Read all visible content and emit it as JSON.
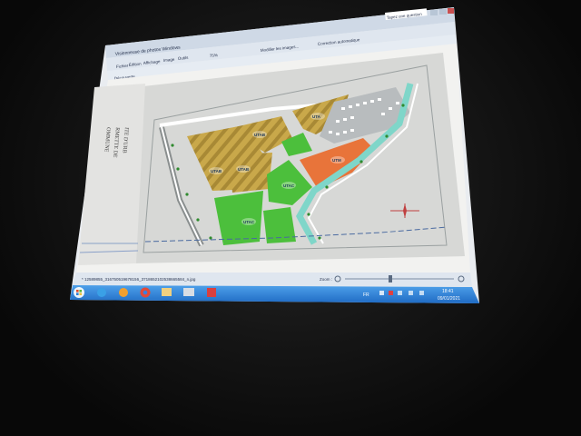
{
  "window": {
    "title": "Visionneuse de photos Windows",
    "search_placeholder": "Tapez une question"
  },
  "menu": {
    "items": [
      "Fichier",
      "Édition",
      "Affichage",
      "Image",
      "Outils"
    ],
    "zoom": "75%",
    "modify_images": "Modifier les images...",
    "auto_correct": "Correction automatique"
  },
  "toolbar": {
    "left_label": "Découverte..."
  },
  "plan": {
    "zones": [
      {
        "label": "UTAB"
      },
      {
        "label": "UTAB"
      },
      {
        "label": "UTAB"
      },
      {
        "label": "UTA"
      },
      {
        "label": "UTM"
      },
      {
        "label": "UTAC"
      },
      {
        "label": "UTAC"
      }
    ],
    "side_text": [
      "OMMUNE",
      "RMETTE DE",
      "ITE D'URB"
    ]
  },
  "statusbar": {
    "filename": "* 12589855_316750519678156_3718652102538665584_n.jpg",
    "zoom_label": "Zoom :"
  },
  "taskbar": {
    "lang": "FR",
    "time": "18:41",
    "date": "09/01/2021"
  },
  "colors": {
    "taskbar": "#2a7fd6",
    "orange_zone": "#e8743a",
    "green_zone": "#4cbf3c",
    "hatched_zone": "#c9a84a",
    "canal": "#7fd6c9"
  }
}
